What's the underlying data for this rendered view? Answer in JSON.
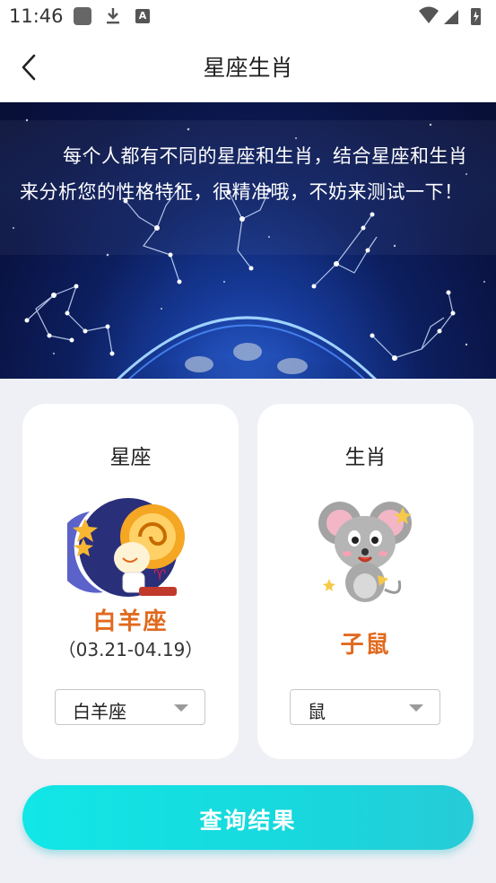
{
  "status_bar": {
    "time": "11:46",
    "icons": [
      "gallery-icon",
      "download-icon",
      "font-a-icon",
      "wifi-icon",
      "signal-icon",
      "battery-icon"
    ]
  },
  "header": {
    "title": "星座生肖",
    "back_icon": "chevron-left-icon"
  },
  "banner": {
    "intro": "每个人都有不同的星座和生肖，结合星座和生肖来分析您的性格特征，很精准哦，不妨来测试一下！"
  },
  "constellation_card": {
    "title": "星座",
    "image": "aries-illustration",
    "name": "白羊座",
    "date_range": "（03.21-04.19）",
    "select_value": "白羊座"
  },
  "zodiac_card": {
    "title": "生肖",
    "image": "mouse-illustration",
    "name": "子鼠",
    "select_value": "鼠"
  },
  "query_button": {
    "label": "查询结果"
  },
  "colors": {
    "accent_orange": "#e16a1e",
    "button_start": "#12e6e6",
    "button_end": "#27cbd8",
    "banner_bg": "#0a1445",
    "page_bg": "#eef0f5"
  }
}
